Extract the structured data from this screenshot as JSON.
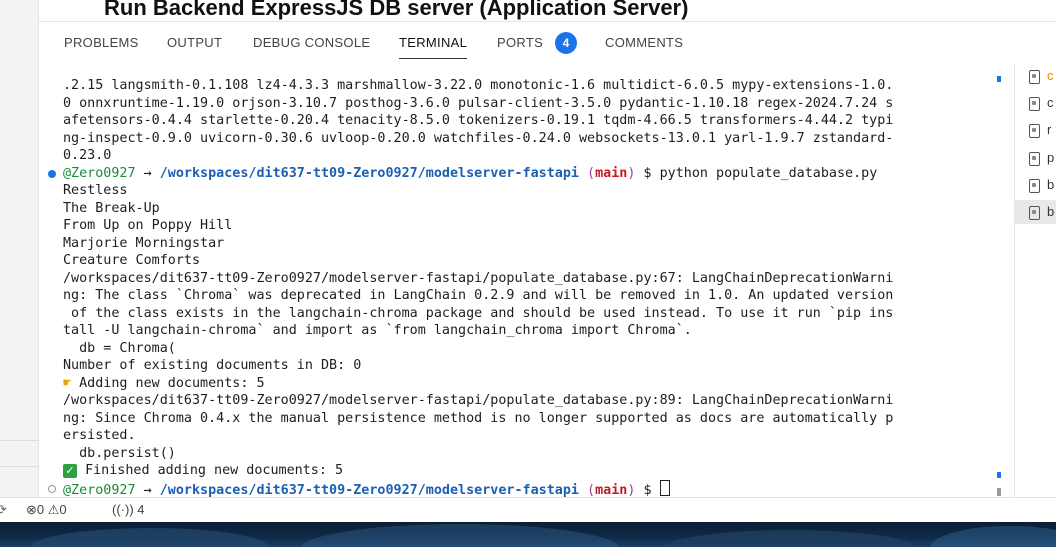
{
  "document": {
    "title": "Run Backend ExpressJS DB server (Application Server)"
  },
  "panel": {
    "tabs": [
      {
        "label": "PROBLEMS"
      },
      {
        "label": "OUTPUT"
      },
      {
        "label": "DEBUG CONSOLE"
      },
      {
        "label": "TERMINAL",
        "active": true
      },
      {
        "label": "PORTS",
        "badge": "4"
      },
      {
        "label": "COMMENTS"
      }
    ]
  },
  "terminal": {
    "lines": [
      ".2.15 langsmith-0.1.108 lz4-4.3.3 marshmallow-3.22.0 monotonic-1.6 multidict-6.0.5 mypy-extensions-1.0.",
      "0 onnxruntime-1.19.0 orjson-3.10.7 posthog-3.6.0 pulsar-client-3.5.0 pydantic-1.10.18 regex-2024.7.24 s",
      "afetensors-0.4.4 starlette-0.20.4 tenacity-8.5.0 tokenizers-0.19.1 tqdm-4.66.5 transformers-4.44.2 typi",
      "ng-inspect-0.9.0 uvicorn-0.30.6 uvloop-0.20.0 watchfiles-0.24.0 websockets-13.0.1 yarl-1.9.7 zstandard-",
      "0.23.0"
    ],
    "prompt1": {
      "user": "@Zero0927",
      "arrow": "→",
      "path": "/workspaces/dit637-tt09-Zero0927/modelserver-fastapi",
      "branch": "main",
      "symbol": "$",
      "command": "python populate_database.py"
    },
    "output": [
      "Restless",
      "The Break-Up",
      "From Up on Poppy Hill",
      "Marjorie Morningstar",
      "Creature Comforts",
      "/workspaces/dit637-tt09-Zero0927/modelserver-fastapi/populate_database.py:67: LangChainDeprecationWarni",
      "ng: The class `Chroma` was deprecated in LangChain 0.2.9 and will be removed in 1.0. An updated version",
      " of the class exists in the langchain-chroma package and should be used instead. To use it run `pip ins",
      "tall -U langchain-chroma` and import as `from langchain_chroma import Chroma`.",
      "  db = Chroma(",
      "Number of existing documents in DB: 0"
    ],
    "adding_line": "Adding new documents: 5",
    "adding_icon": "pointing-hand-emoji",
    "output2": [
      "/workspaces/dit637-tt09-Zero0927/modelserver-fastapi/populate_database.py:89: LangChainDeprecationWarni",
      "ng: Since Chroma 0.4.x the manual persistence method is no longer supported as docs are automatically p",
      "ersisted.",
      "  db.persist()"
    ],
    "finished_line": "Finished adding new documents: 5",
    "finished_icon": "check-mark-emoji",
    "prompt2": {
      "user": "@Zero0927",
      "arrow": "→",
      "path": "/workspaces/dit637-tt09-Zero0927/modelserver-fastapi",
      "branch": "main",
      "symbol": "$"
    }
  },
  "side_list": {
    "items": [
      {
        "letter": "c",
        "highlight": "orange"
      },
      {
        "letter": "c"
      },
      {
        "letter": "r"
      },
      {
        "letter": "p"
      },
      {
        "letter": "b"
      },
      {
        "letter": "b",
        "selected": true
      }
    ]
  },
  "statusbar": {
    "errors": "0",
    "warnings": "0",
    "ports": "4"
  },
  "colors": {
    "accent": "#1a73e8",
    "path": "#1a5fb4",
    "branch": "#c01c28",
    "user": "#1a8a3a"
  }
}
